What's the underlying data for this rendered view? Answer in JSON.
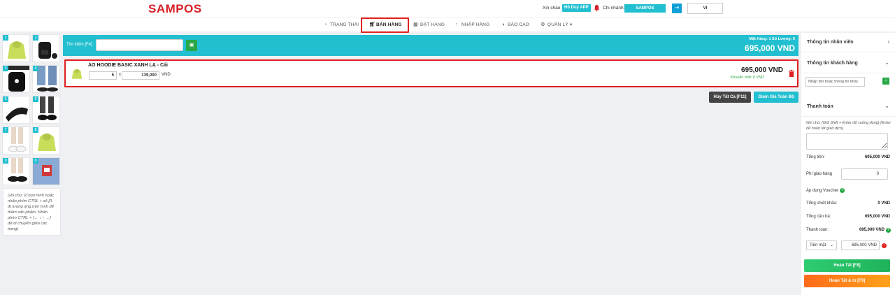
{
  "header": {
    "logo": "SAMPOS",
    "greeting": "Xin chào",
    "user": "Hồ Duy APP",
    "branch_label": "Chi nhánh:",
    "branch": "SAMPOS",
    "language": "VI"
  },
  "nav": {
    "items": [
      {
        "label": "TRẠNG THÁI",
        "icon": "dashboard-icon"
      },
      {
        "label": "BÁN HÀNG",
        "icon": "cart-icon"
      },
      {
        "label": "ĐẶT HÀNG",
        "icon": "calendar-icon"
      },
      {
        "label": "NHẬP HÀNG",
        "icon": "upload-icon"
      },
      {
        "label": "BÁO CÁO",
        "icon": "chart-icon"
      },
      {
        "label": "QUẢN LÝ",
        "icon": "gear-icon"
      }
    ],
    "active": "BÁN HÀNG"
  },
  "grid": {
    "products": [
      {
        "num": "1",
        "image": "green-hoodie"
      },
      {
        "num": "2",
        "image": "black-backpack"
      },
      {
        "num": "3",
        "image": "black-backpack-2"
      },
      {
        "num": "4",
        "image": "sandals-on-jeans"
      },
      {
        "num": "5",
        "image": "black-slide"
      },
      {
        "num": "6",
        "image": "black-loafers"
      },
      {
        "num": "7",
        "image": "white-sneakers"
      },
      {
        "num": "8",
        "image": "green-hoodie"
      },
      {
        "num": "9",
        "image": "black-sneakers"
      },
      {
        "num": "0",
        "image": "blue-tshirt"
      }
    ],
    "note": "Ghi chú: (Chọn hình hoặc nhấn phím CTRL + số [0-9] tương ứng trên hình để thêm sản phẩm. Nhấn phím CTRL + [← ↓ ↑ →] để di chuyển giữa các trang)"
  },
  "search": {
    "label": "Tìm kiếm [F4]",
    "placeholder": "",
    "summary": "Mặt Hàng: 1  Số Lượng: 5",
    "total": "695,000 VND"
  },
  "cart": {
    "items": [
      {
        "name": "ÁO HOODIE BASIC XANH LẠ - Cái",
        "qty": "5",
        "x": "x",
        "price": "139,000",
        "unit": "VND",
        "total": "695,000 VND",
        "discount": "Khuyến mãi: 0 VND"
      }
    ],
    "cancel_all": "Hủy Tất Cả [F11]",
    "discount_all": "Giảm Giá Toàn Bộ"
  },
  "panel": {
    "staff_title": "Thông tin nhân viên",
    "customer_title": "Thông tin khách hàng",
    "customer_placeholder": "Nhập tên hoặc thông tin khác",
    "payment_title": "Thanh toán",
    "note_label": "Ghi chú:",
    "note_hint": "(Giữ Shift + Enter để xuống dòng) (Enter để hoàn tất giao dịch)",
    "subtotal_label": "Tổng tiền:",
    "subtotal": "695,000 VND",
    "shipping_label": "Phí giao hàng",
    "shipping": "0",
    "voucher_label": "Áp dụng Voucher",
    "discount_label": "Tổng chiết khấu:",
    "discount": "0 VND",
    "due_label": "Tổng cần trả:",
    "due": "695,000 VND",
    "paid_label": "Thanh toán:",
    "paid": "695,000 VND",
    "method": "Tiền mặt",
    "amount": "695,000",
    "amount_unit": "VND",
    "finish": "Hoàn Tất [F8]",
    "finish_print": "Hoàn Tất & In [F9]"
  }
}
